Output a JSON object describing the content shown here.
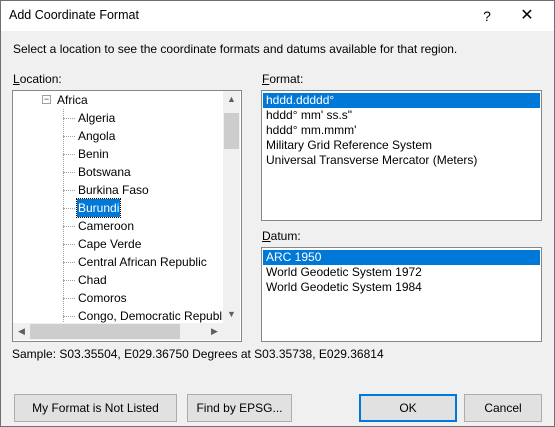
{
  "window": {
    "title": "Add Coordinate Format",
    "help_glyph": "?",
    "close_glyph": "✕"
  },
  "instruction": "Select a location to see the coordinate formats and datums available for that region.",
  "location": {
    "label": "Location:",
    "root": {
      "label": "Africa",
      "expander": "−"
    },
    "items": [
      "Algeria",
      "Angola",
      "Benin",
      "Botswana",
      "Burkina Faso",
      "Burundi",
      "Cameroon",
      "Cape Verde",
      "Central African Republic",
      "Chad",
      "Comoros",
      "Congo, Democratic Republi"
    ],
    "selected": "Burundi"
  },
  "format": {
    "label": "Format:",
    "items": [
      "hddd.ddddd°",
      "hddd° mm' ss.s\"",
      "hddd° mm.mmm'",
      "Military Grid Reference System",
      "Universal Transverse Mercator (Meters)"
    ],
    "selected": "hddd.ddddd°"
  },
  "datum": {
    "label": "Datum:",
    "items": [
      "ARC 1950",
      "World Geodetic System 1972",
      "World Geodetic System 1984"
    ],
    "selected": "ARC 1950"
  },
  "sample": "Sample: S03.35504, E029.36750 Degrees at S03.35738, E029.36814",
  "buttons": {
    "not_listed": "My Format is Not Listed",
    "find_epsg": "Find by EPSG...",
    "ok": "OK",
    "cancel": "Cancel"
  },
  "scroll_glyphs": {
    "up": "▲",
    "down": "▼",
    "left": "◀",
    "right": "▶"
  }
}
